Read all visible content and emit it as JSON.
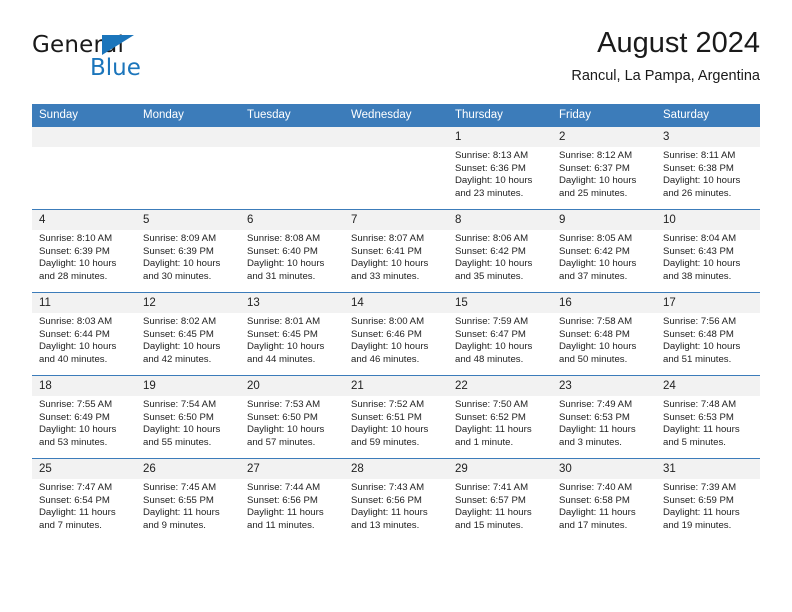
{
  "brand": {
    "name_top": "General",
    "name_bottom": "Blue",
    "flag_color": "#1b75bb"
  },
  "header": {
    "title": "August 2024",
    "subtitle": "Rancul, La Pampa, Argentina"
  },
  "theme": {
    "header_bg": "#3c7cba",
    "daynum_bg": "#f2f2f2",
    "text": "#222222"
  },
  "weekday_headers": [
    "Sunday",
    "Monday",
    "Tuesday",
    "Wednesday",
    "Thursday",
    "Friday",
    "Saturday"
  ],
  "weeks": [
    [
      {
        "day": "",
        "lines": []
      },
      {
        "day": "",
        "lines": []
      },
      {
        "day": "",
        "lines": []
      },
      {
        "day": "",
        "lines": []
      },
      {
        "day": "1",
        "lines": [
          "Sunrise: 8:13 AM",
          "Sunset: 6:36 PM",
          "Daylight: 10 hours",
          "and 23 minutes."
        ]
      },
      {
        "day": "2",
        "lines": [
          "Sunrise: 8:12 AM",
          "Sunset: 6:37 PM",
          "Daylight: 10 hours",
          "and 25 minutes."
        ]
      },
      {
        "day": "3",
        "lines": [
          "Sunrise: 8:11 AM",
          "Sunset: 6:38 PM",
          "Daylight: 10 hours",
          "and 26 minutes."
        ]
      }
    ],
    [
      {
        "day": "4",
        "lines": [
          "Sunrise: 8:10 AM",
          "Sunset: 6:39 PM",
          "Daylight: 10 hours",
          "and 28 minutes."
        ]
      },
      {
        "day": "5",
        "lines": [
          "Sunrise: 8:09 AM",
          "Sunset: 6:39 PM",
          "Daylight: 10 hours",
          "and 30 minutes."
        ]
      },
      {
        "day": "6",
        "lines": [
          "Sunrise: 8:08 AM",
          "Sunset: 6:40 PM",
          "Daylight: 10 hours",
          "and 31 minutes."
        ]
      },
      {
        "day": "7",
        "lines": [
          "Sunrise: 8:07 AM",
          "Sunset: 6:41 PM",
          "Daylight: 10 hours",
          "and 33 minutes."
        ]
      },
      {
        "day": "8",
        "lines": [
          "Sunrise: 8:06 AM",
          "Sunset: 6:42 PM",
          "Daylight: 10 hours",
          "and 35 minutes."
        ]
      },
      {
        "day": "9",
        "lines": [
          "Sunrise: 8:05 AM",
          "Sunset: 6:42 PM",
          "Daylight: 10 hours",
          "and 37 minutes."
        ]
      },
      {
        "day": "10",
        "lines": [
          "Sunrise: 8:04 AM",
          "Sunset: 6:43 PM",
          "Daylight: 10 hours",
          "and 38 minutes."
        ]
      }
    ],
    [
      {
        "day": "11",
        "lines": [
          "Sunrise: 8:03 AM",
          "Sunset: 6:44 PM",
          "Daylight: 10 hours",
          "and 40 minutes."
        ]
      },
      {
        "day": "12",
        "lines": [
          "Sunrise: 8:02 AM",
          "Sunset: 6:45 PM",
          "Daylight: 10 hours",
          "and 42 minutes."
        ]
      },
      {
        "day": "13",
        "lines": [
          "Sunrise: 8:01 AM",
          "Sunset: 6:45 PM",
          "Daylight: 10 hours",
          "and 44 minutes."
        ]
      },
      {
        "day": "14",
        "lines": [
          "Sunrise: 8:00 AM",
          "Sunset: 6:46 PM",
          "Daylight: 10 hours",
          "and 46 minutes."
        ]
      },
      {
        "day": "15",
        "lines": [
          "Sunrise: 7:59 AM",
          "Sunset: 6:47 PM",
          "Daylight: 10 hours",
          "and 48 minutes."
        ]
      },
      {
        "day": "16",
        "lines": [
          "Sunrise: 7:58 AM",
          "Sunset: 6:48 PM",
          "Daylight: 10 hours",
          "and 50 minutes."
        ]
      },
      {
        "day": "17",
        "lines": [
          "Sunrise: 7:56 AM",
          "Sunset: 6:48 PM",
          "Daylight: 10 hours",
          "and 51 minutes."
        ]
      }
    ],
    [
      {
        "day": "18",
        "lines": [
          "Sunrise: 7:55 AM",
          "Sunset: 6:49 PM",
          "Daylight: 10 hours",
          "and 53 minutes."
        ]
      },
      {
        "day": "19",
        "lines": [
          "Sunrise: 7:54 AM",
          "Sunset: 6:50 PM",
          "Daylight: 10 hours",
          "and 55 minutes."
        ]
      },
      {
        "day": "20",
        "lines": [
          "Sunrise: 7:53 AM",
          "Sunset: 6:50 PM",
          "Daylight: 10 hours",
          "and 57 minutes."
        ]
      },
      {
        "day": "21",
        "lines": [
          "Sunrise: 7:52 AM",
          "Sunset: 6:51 PM",
          "Daylight: 10 hours",
          "and 59 minutes."
        ]
      },
      {
        "day": "22",
        "lines": [
          "Sunrise: 7:50 AM",
          "Sunset: 6:52 PM",
          "Daylight: 11 hours",
          "and 1 minute."
        ]
      },
      {
        "day": "23",
        "lines": [
          "Sunrise: 7:49 AM",
          "Sunset: 6:53 PM",
          "Daylight: 11 hours",
          "and 3 minutes."
        ]
      },
      {
        "day": "24",
        "lines": [
          "Sunrise: 7:48 AM",
          "Sunset: 6:53 PM",
          "Daylight: 11 hours",
          "and 5 minutes."
        ]
      }
    ],
    [
      {
        "day": "25",
        "lines": [
          "Sunrise: 7:47 AM",
          "Sunset: 6:54 PM",
          "Daylight: 11 hours",
          "and 7 minutes."
        ]
      },
      {
        "day": "26",
        "lines": [
          "Sunrise: 7:45 AM",
          "Sunset: 6:55 PM",
          "Daylight: 11 hours",
          "and 9 minutes."
        ]
      },
      {
        "day": "27",
        "lines": [
          "Sunrise: 7:44 AM",
          "Sunset: 6:56 PM",
          "Daylight: 11 hours",
          "and 11 minutes."
        ]
      },
      {
        "day": "28",
        "lines": [
          "Sunrise: 7:43 AM",
          "Sunset: 6:56 PM",
          "Daylight: 11 hours",
          "and 13 minutes."
        ]
      },
      {
        "day": "29",
        "lines": [
          "Sunrise: 7:41 AM",
          "Sunset: 6:57 PM",
          "Daylight: 11 hours",
          "and 15 minutes."
        ]
      },
      {
        "day": "30",
        "lines": [
          "Sunrise: 7:40 AM",
          "Sunset: 6:58 PM",
          "Daylight: 11 hours",
          "and 17 minutes."
        ]
      },
      {
        "day": "31",
        "lines": [
          "Sunrise: 7:39 AM",
          "Sunset: 6:59 PM",
          "Daylight: 11 hours",
          "and 19 minutes."
        ]
      }
    ]
  ]
}
